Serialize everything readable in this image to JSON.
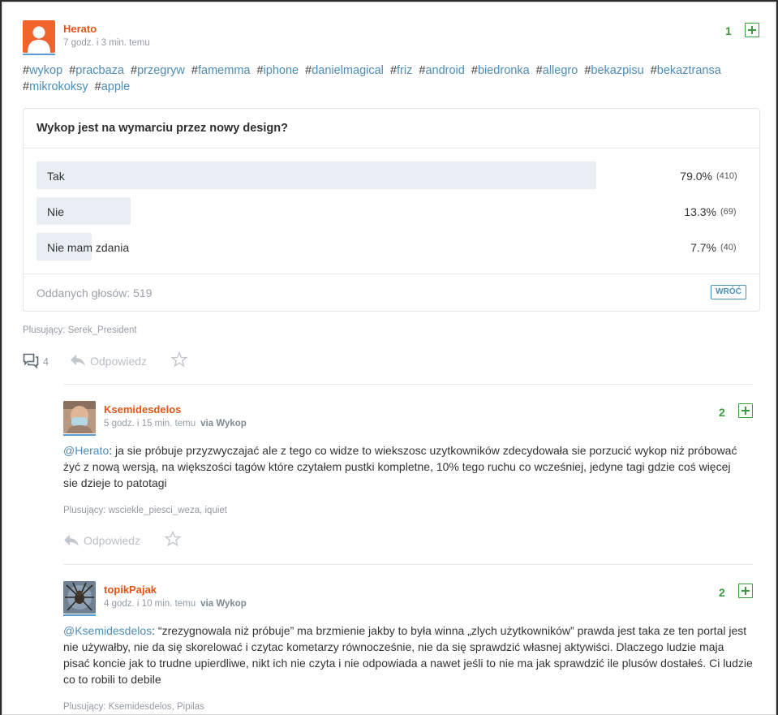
{
  "post": {
    "username": "Herato",
    "time": "7 godz. i 3 min. temu",
    "votes": "1",
    "tags": [
      "wykop",
      "pracbaza",
      "przegryw",
      "famemma",
      "iphone",
      "danielmagical",
      "friz",
      "android",
      "biedronka",
      "allegro",
      "bekazpisu",
      "bekaztransa",
      "mikrokoksy",
      "apple"
    ],
    "poll": {
      "question": "Wykop jest na wymarciu przez nowy design?",
      "options": [
        {
          "label": "Tak",
          "percent": "79.0%",
          "count": "(410)",
          "fraction": 0.79
        },
        {
          "label": "Nie",
          "percent": "13.3%",
          "count": "(69)",
          "fraction": 0.133
        },
        {
          "label": "Nie mam zdania",
          "percent": "7.7%",
          "count": "(40)",
          "fraction": 0.077
        }
      ],
      "total": "Oddanych głosów: 519",
      "back_label": "WRÓĆ"
    },
    "plusers": "Plusujący: Serek_President",
    "comment_count": "4",
    "reply_label": "Odpowiedz"
  },
  "comments": [
    {
      "username": "Ksemidesdelos",
      "time": "5 godz. i 15 min. temu",
      "via": "via Wykop",
      "votes": "2",
      "mention": "@Herato",
      "text": ": ja sie próbuje przyzwyczajać ale z tego co widze to wiekszosc uzytkowników zdecydowała sie porzucić wykop niż próbować żyć z nową wersją, na większości tagów które czytałem pustki kompletne, 10% tego ruchu co wcześniej, jedyne tagi gdzie coś więcej sie dzieje to patotagi",
      "plusers": "Plusujący: wsciekle_piesci_weza, iquiet",
      "reply_label": "Odpowiedz"
    },
    {
      "username": "topikPajak",
      "time": "4 godz. i 10 min. temu",
      "via": "via Wykop",
      "votes": "2",
      "mention": "@Ksemidesdelos",
      "text": ": “zrezygnowala niż próbuje” ma brzmienie jakby to była winna „zlych użytkowników” prawda jest taka ze ten portal jest nie używałby, nie da się skorelować i czytac kometarzy równocześnie, nie da się sprawdzić własnej aktywiści. Dlaczego ludzie maja pisać koncie jak to trudne upierdliwe, nikt ich nie czyta i nie odpowiada a nawet jeśli to nie ma jak sprawdzić ile plusów dostałeś. Ci ludzie co to robili to debile",
      "plusers": "Plusujący: Ksemidesdelos, Pipilas"
    }
  ],
  "colors": {
    "accent": "#4b8db8",
    "username": "#e0561a",
    "vote": "#3d9b3d",
    "avatar_orange": "#f0642b"
  }
}
